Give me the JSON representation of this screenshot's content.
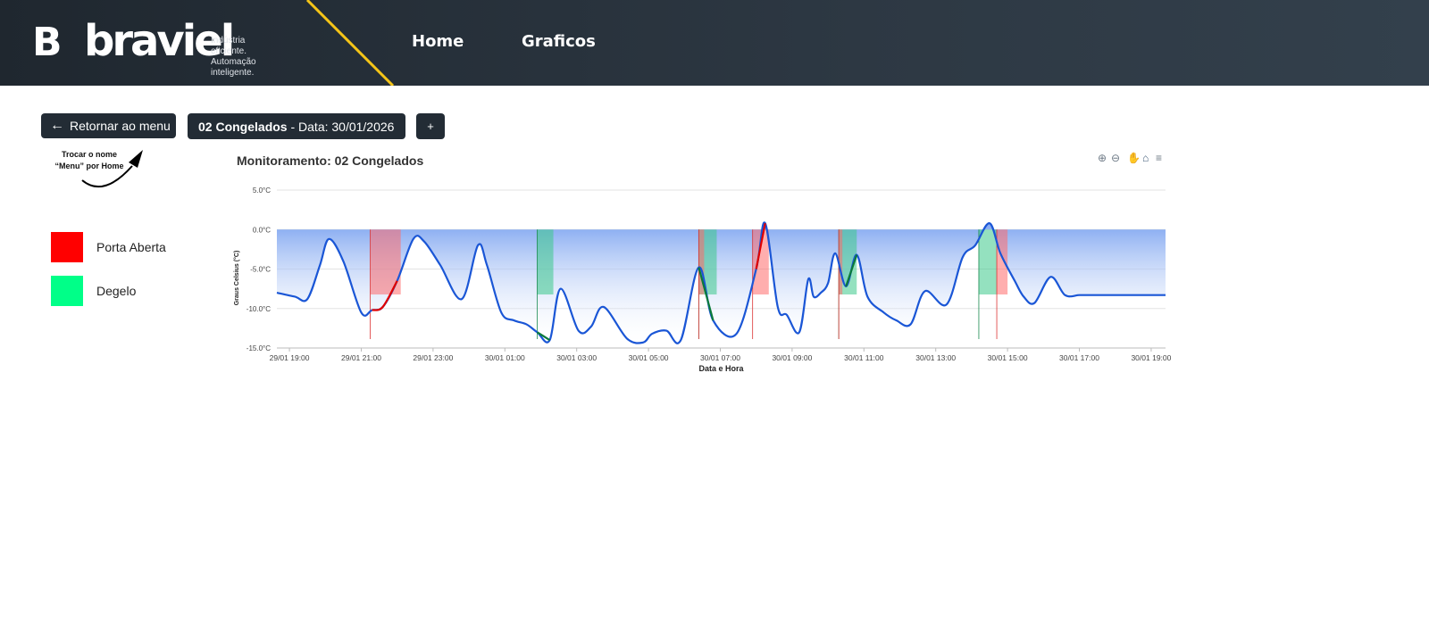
{
  "header": {
    "logo_mark": "B",
    "logo_word": "braviel",
    "tagline_1": "Indústria eficiente.",
    "tagline_2": "Automação inteligente.",
    "nav": [
      "Home",
      "Graficos"
    ],
    "colors": {
      "bg": "#1f272f",
      "accent_stripe": "#f5c518"
    }
  },
  "toolbar": {
    "back_label": "Retornar ao menu",
    "back_icon": "arrow-left-icon",
    "date_bold": "02 Congelados",
    "date_rest": "- Data: 30/01/2026",
    "plus_label": "+"
  },
  "annotation": {
    "line1": "Trocar o nome",
    "line2": "“Menu” por Home"
  },
  "legend": [
    {
      "label": "Porta Aberta",
      "color": "#ff0000"
    },
    {
      "label": "Degelo",
      "color": "#00ff88"
    }
  ],
  "chart_icons": [
    "zoom-in-icon",
    "zoom-out-icon",
    "pan-icon",
    "home-icon",
    "menu-icon"
  ],
  "chart_data": {
    "type": "area",
    "title": "Monitoramento: 02 Congelados",
    "xlabel": "Data e Hora",
    "ylabel": "Graus Celsius (°C)",
    "ylim": [
      -15,
      5
    ],
    "y_ticks": [
      "5.0°C",
      "0.0°C",
      "-5.0°C",
      "-10.0°C",
      "-15.0°C"
    ],
    "x_ticks": [
      "29/01 19:00",
      "29/01 21:00",
      "29/01 23:00",
      "30/01 01:00",
      "30/01 03:00",
      "30/01 05:00",
      "30/01 07:00",
      "30/01 09:00",
      "30/01 11:00",
      "30/01 13:00",
      "30/01 15:00",
      "30/01 17:00",
      "30/01 19:00"
    ],
    "x_hours_from_first_tick_range": [
      -0.35,
      24.4
    ],
    "series": [
      {
        "x": [
          -0.35,
          0.15,
          0.5,
          0.85,
          1.1,
          1.5,
          2.0,
          2.3,
          2.6,
          3.0,
          3.45,
          3.75,
          4.2,
          4.8,
          5.25,
          5.5,
          5.9,
          6.25,
          6.6,
          6.9,
          7.25,
          7.55,
          8.05,
          8.4,
          8.75,
          9.4,
          9.85,
          10.1,
          10.5,
          10.9,
          11.4,
          11.8,
          12.45,
          13.0,
          13.25,
          13.6,
          13.85,
          14.2,
          14.45,
          14.6,
          14.8,
          15.0,
          15.2,
          15.5,
          15.8,
          16.1,
          16.55,
          16.9,
          17.3,
          17.7,
          18.3,
          18.75,
          19.1,
          19.5,
          19.8,
          20.2,
          20.45,
          20.75,
          21.2,
          21.6,
          22.0,
          22.3,
          22.6,
          22.9,
          23.3,
          23.6,
          23.9,
          24.4
        ],
        "y": [
          -8.0,
          -8.5,
          -8.8,
          -4.5,
          -1.2,
          -4.0,
          -10.5,
          -10.2,
          -9.8,
          -6.5,
          -1.2,
          -1.5,
          -4.5,
          -8.8,
          -2.0,
          -4.5,
          -10.5,
          -11.5,
          -12.0,
          -13.0,
          -14.0,
          -7.5,
          -12.8,
          -12.3,
          -9.8,
          -13.8,
          -14.3,
          -13.2,
          -12.8,
          -14.0,
          -4.8,
          -11.5,
          -13.2,
          -5.0,
          0.8,
          -9.8,
          -10.8,
          -13.0,
          -6.3,
          -8.5,
          -8.0,
          -6.8,
          -3.0,
          -7.2,
          -3.2,
          -8.5,
          -10.5,
          -11.5,
          -12.0,
          -7.8,
          -9.5,
          -3.5,
          -2.0,
          0.8,
          -3.0,
          -6.5,
          -8.5,
          -9.3,
          -6.0,
          -8.3,
          -8.3,
          -8.3,
          -8.3,
          -8.3,
          -8.3,
          -8.3,
          -8.3,
          -8.3
        ]
      }
    ],
    "bands": [
      {
        "kind": "Porta Aberta",
        "from": 2.25,
        "to": 3.1
      },
      {
        "kind": "Degelo",
        "from": 6.9,
        "to": 7.35
      },
      {
        "kind": "Degelo",
        "from": 11.4,
        "to": 11.9
      },
      {
        "kind": "Porta Aberta",
        "from": 11.4,
        "to": 11.55
      },
      {
        "kind": "Porta Aberta",
        "from": 12.9,
        "to": 13.35
      },
      {
        "kind": "Degelo",
        "from": 15.3,
        "to": 15.8
      },
      {
        "kind": "Porta Aberta",
        "from": 15.3,
        "to": 15.4
      },
      {
        "kind": "Degelo",
        "from": 19.2,
        "to": 19.7
      },
      {
        "kind": "Porta Aberta",
        "from": 19.7,
        "to": 20.0
      }
    ],
    "grid": true,
    "legend": "left"
  }
}
